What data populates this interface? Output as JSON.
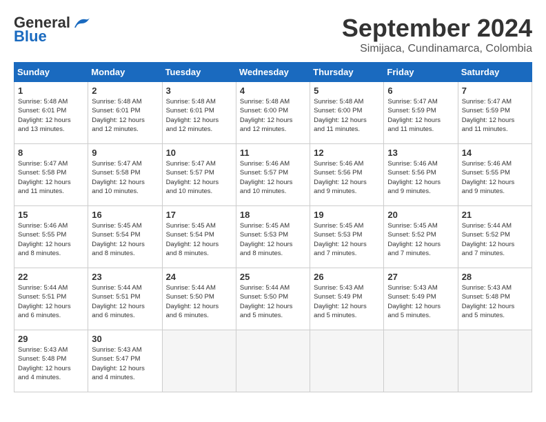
{
  "header": {
    "logo_general": "General",
    "logo_blue": "Blue",
    "month_title": "September 2024",
    "location": "Simijaca, Cundinamarca, Colombia"
  },
  "days_of_week": [
    "Sunday",
    "Monday",
    "Tuesday",
    "Wednesday",
    "Thursday",
    "Friday",
    "Saturday"
  ],
  "weeks": [
    [
      {
        "day": 1,
        "sunrise": "5:48 AM",
        "sunset": "6:01 PM",
        "daylight": "12 hours and 13 minutes."
      },
      {
        "day": 2,
        "sunrise": "5:48 AM",
        "sunset": "6:01 PM",
        "daylight": "12 hours and 12 minutes."
      },
      {
        "day": 3,
        "sunrise": "5:48 AM",
        "sunset": "6:01 PM",
        "daylight": "12 hours and 12 minutes."
      },
      {
        "day": 4,
        "sunrise": "5:48 AM",
        "sunset": "6:00 PM",
        "daylight": "12 hours and 12 minutes."
      },
      {
        "day": 5,
        "sunrise": "5:48 AM",
        "sunset": "6:00 PM",
        "daylight": "12 hours and 11 minutes."
      },
      {
        "day": 6,
        "sunrise": "5:47 AM",
        "sunset": "5:59 PM",
        "daylight": "12 hours and 11 minutes."
      },
      {
        "day": 7,
        "sunrise": "5:47 AM",
        "sunset": "5:59 PM",
        "daylight": "12 hours and 11 minutes."
      }
    ],
    [
      {
        "day": 8,
        "sunrise": "5:47 AM",
        "sunset": "5:58 PM",
        "daylight": "12 hours and 11 minutes."
      },
      {
        "day": 9,
        "sunrise": "5:47 AM",
        "sunset": "5:58 PM",
        "daylight": "12 hours and 10 minutes."
      },
      {
        "day": 10,
        "sunrise": "5:47 AM",
        "sunset": "5:57 PM",
        "daylight": "12 hours and 10 minutes."
      },
      {
        "day": 11,
        "sunrise": "5:46 AM",
        "sunset": "5:57 PM",
        "daylight": "12 hours and 10 minutes."
      },
      {
        "day": 12,
        "sunrise": "5:46 AM",
        "sunset": "5:56 PM",
        "daylight": "12 hours and 9 minutes."
      },
      {
        "day": 13,
        "sunrise": "5:46 AM",
        "sunset": "5:56 PM",
        "daylight": "12 hours and 9 minutes."
      },
      {
        "day": 14,
        "sunrise": "5:46 AM",
        "sunset": "5:55 PM",
        "daylight": "12 hours and 9 minutes."
      }
    ],
    [
      {
        "day": 15,
        "sunrise": "5:46 AM",
        "sunset": "5:55 PM",
        "daylight": "12 hours and 8 minutes."
      },
      {
        "day": 16,
        "sunrise": "5:45 AM",
        "sunset": "5:54 PM",
        "daylight": "12 hours and 8 minutes."
      },
      {
        "day": 17,
        "sunrise": "5:45 AM",
        "sunset": "5:54 PM",
        "daylight": "12 hours and 8 minutes."
      },
      {
        "day": 18,
        "sunrise": "5:45 AM",
        "sunset": "5:53 PM",
        "daylight": "12 hours and 8 minutes."
      },
      {
        "day": 19,
        "sunrise": "5:45 AM",
        "sunset": "5:53 PM",
        "daylight": "12 hours and 7 minutes."
      },
      {
        "day": 20,
        "sunrise": "5:45 AM",
        "sunset": "5:52 PM",
        "daylight": "12 hours and 7 minutes."
      },
      {
        "day": 21,
        "sunrise": "5:44 AM",
        "sunset": "5:52 PM",
        "daylight": "12 hours and 7 minutes."
      }
    ],
    [
      {
        "day": 22,
        "sunrise": "5:44 AM",
        "sunset": "5:51 PM",
        "daylight": "12 hours and 6 minutes."
      },
      {
        "day": 23,
        "sunrise": "5:44 AM",
        "sunset": "5:51 PM",
        "daylight": "12 hours and 6 minutes."
      },
      {
        "day": 24,
        "sunrise": "5:44 AM",
        "sunset": "5:50 PM",
        "daylight": "12 hours and 6 minutes."
      },
      {
        "day": 25,
        "sunrise": "5:44 AM",
        "sunset": "5:50 PM",
        "daylight": "12 hours and 5 minutes."
      },
      {
        "day": 26,
        "sunrise": "5:43 AM",
        "sunset": "5:49 PM",
        "daylight": "12 hours and 5 minutes."
      },
      {
        "day": 27,
        "sunrise": "5:43 AM",
        "sunset": "5:49 PM",
        "daylight": "12 hours and 5 minutes."
      },
      {
        "day": 28,
        "sunrise": "5:43 AM",
        "sunset": "5:48 PM",
        "daylight": "12 hours and 5 minutes."
      }
    ],
    [
      {
        "day": 29,
        "sunrise": "5:43 AM",
        "sunset": "5:48 PM",
        "daylight": "12 hours and 4 minutes."
      },
      {
        "day": 30,
        "sunrise": "5:43 AM",
        "sunset": "5:47 PM",
        "daylight": "12 hours and 4 minutes."
      },
      null,
      null,
      null,
      null,
      null
    ]
  ]
}
